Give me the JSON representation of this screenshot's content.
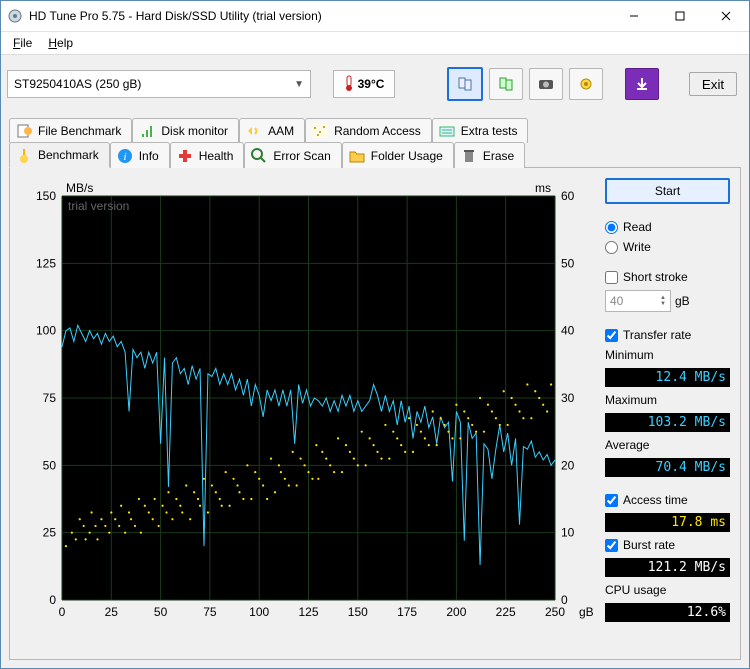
{
  "window": {
    "title": "HD Tune Pro 5.75 - Hard Disk/SSD Utility (trial version)"
  },
  "menu": {
    "file": "File",
    "help": "Help"
  },
  "toolbar": {
    "drive_selected": "ST9250410AS (250 gB)",
    "temperature": "39°C",
    "exit_label": "Exit"
  },
  "tabs_row_top": [
    {
      "label": "File Benchmark",
      "icon": "file-bench-icon"
    },
    {
      "label": "Disk monitor",
      "icon": "disk-monitor-icon"
    },
    {
      "label": "AAM",
      "icon": "aam-icon"
    },
    {
      "label": "Random Access",
      "icon": "random-icon"
    },
    {
      "label": "Extra tests",
      "icon": "extra-icon"
    }
  ],
  "tabs_row_bottom": [
    {
      "label": "Benchmark",
      "icon": "bench-icon",
      "selected": true
    },
    {
      "label": "Info",
      "icon": "info-icon"
    },
    {
      "label": "Health",
      "icon": "health-icon"
    },
    {
      "label": "Error Scan",
      "icon": "error-icon"
    },
    {
      "label": "Folder Usage",
      "icon": "folder-icon"
    },
    {
      "label": "Erase",
      "icon": "erase-icon"
    }
  ],
  "side": {
    "start_label": "Start",
    "read_label": "Read",
    "write_label": "Write",
    "short_stroke_label": "Short stroke",
    "short_stroke_value": "40",
    "short_stroke_unit": "gB",
    "transfer_rate_label": "Transfer rate",
    "min_label": "Minimum",
    "min_value": "12.4 MB/s",
    "max_label": "Maximum",
    "max_value": "103.2 MB/s",
    "avg_label": "Average",
    "avg_value": "70.4 MB/s",
    "access_label": "Access time",
    "access_value": "17.8 ms",
    "burst_label": "Burst rate",
    "burst_value": "121.2 MB/s",
    "cpu_label": "CPU usage",
    "cpu_value": "12.6%"
  },
  "chart_data": {
    "type": "line+scatter",
    "watermark": "trial version",
    "y_left_label": "MB/s",
    "y_right_label": "ms",
    "x_unit": "gB",
    "xlim": [
      0,
      250
    ],
    "ylim_left": [
      0,
      150
    ],
    "ylim_right": [
      0,
      60
    ],
    "x_ticks": [
      0,
      25,
      50,
      75,
      100,
      125,
      150,
      175,
      200,
      225,
      250
    ],
    "y_left_ticks": [
      0,
      25,
      50,
      75,
      100,
      125,
      150
    ],
    "y_right_ticks": [
      0,
      10,
      20,
      30,
      40,
      50,
      60
    ],
    "series": [
      {
        "name": "Transfer rate",
        "color": "#39d0ff",
        "axis": "left",
        "kind": "line",
        "x": [
          0,
          2,
          4,
          6,
          8,
          10,
          12,
          14,
          16,
          18,
          20,
          22,
          24,
          26,
          28,
          30,
          32,
          34,
          36,
          38,
          40,
          42,
          44,
          46,
          48,
          50,
          52,
          54,
          56,
          58,
          60,
          62,
          64,
          66,
          68,
          70,
          72,
          74,
          76,
          78,
          80,
          82,
          84,
          86,
          88,
          90,
          92,
          94,
          96,
          98,
          100,
          102,
          104,
          106,
          108,
          110,
          112,
          114,
          116,
          118,
          120,
          122,
          124,
          126,
          128,
          130,
          132,
          134,
          136,
          138,
          140,
          142,
          144,
          146,
          148,
          150,
          152,
          154,
          156,
          158,
          160,
          162,
          164,
          166,
          168,
          170,
          172,
          174,
          176,
          178,
          180,
          182,
          184,
          186,
          188,
          190,
          192,
          194,
          196,
          198,
          200,
          202,
          204,
          206,
          208,
          210,
          212,
          214,
          216,
          218,
          220,
          222,
          224,
          226,
          228,
          230,
          232,
          234,
          236,
          238,
          240,
          242,
          244,
          246,
          248,
          250
        ],
        "y": [
          94,
          100,
          101,
          96,
          102,
          99,
          96,
          100,
          97,
          99,
          95,
          99,
          96,
          98,
          94,
          96,
          92,
          70,
          93,
          90,
          92,
          86,
          92,
          88,
          92,
          58,
          90,
          42,
          88,
          90,
          84,
          86,
          80,
          87,
          82,
          86,
          20,
          84,
          83,
          86,
          80,
          84,
          80,
          84,
          78,
          82,
          76,
          82,
          72,
          80,
          76,
          68,
          78,
          74,
          78,
          72,
          78,
          72,
          78,
          58,
          80,
          73,
          78,
          72,
          75,
          74,
          72,
          75,
          70,
          74,
          70,
          76,
          72,
          76,
          70,
          74,
          70,
          72,
          74,
          80,
          76,
          70,
          76,
          70,
          74,
          65,
          74,
          66,
          72,
          60,
          70,
          66,
          72,
          64,
          68,
          58,
          68,
          64,
          66,
          44,
          70,
          66,
          22,
          66,
          60,
          62,
          13,
          58,
          56,
          45,
          56,
          65,
          55,
          62,
          50,
          60,
          28,
          57,
          56,
          59,
          53,
          55,
          52,
          54,
          50,
          52
        ]
      },
      {
        "name": "Access time",
        "color": "#ffe600",
        "axis": "right",
        "kind": "scatter",
        "x": [
          2,
          5,
          7,
          9,
          11,
          12,
          14,
          15,
          17,
          18,
          20,
          22,
          24,
          25,
          27,
          29,
          30,
          32,
          34,
          35,
          37,
          39,
          40,
          42,
          44,
          46,
          47,
          49,
          51,
          53,
          54,
          56,
          58,
          60,
          61,
          63,
          65,
          67,
          69,
          70,
          72,
          74,
          76,
          78,
          80,
          81,
          83,
          85,
          87,
          89,
          90,
          92,
          94,
          96,
          98,
          100,
          102,
          104,
          106,
          108,
          110,
          111,
          113,
          115,
          117,
          119,
          121,
          123,
          125,
          127,
          129,
          130,
          132,
          134,
          136,
          138,
          140,
          142,
          144,
          146,
          148,
          150,
          152,
          154,
          156,
          158,
          160,
          162,
          164,
          166,
          168,
          170,
          172,
          174,
          176,
          178,
          180,
          182,
          184,
          186,
          188,
          190,
          192,
          194,
          196,
          198,
          200,
          202,
          204,
          206,
          208,
          210,
          212,
          214,
          216,
          218,
          220,
          222,
          224,
          226,
          228,
          230,
          232,
          234,
          236,
          238,
          240,
          242,
          244,
          246,
          248
        ],
        "y": [
          8,
          10,
          9,
          12,
          11,
          9,
          10,
          13,
          11,
          9,
          12,
          11,
          10,
          13,
          12,
          11,
          14,
          10,
          13,
          12,
          11,
          15,
          10,
          14,
          13,
          12,
          15,
          11,
          14,
          13,
          16,
          12,
          15,
          14,
          13,
          17,
          12,
          16,
          15,
          14,
          18,
          13,
          17,
          16,
          15,
          14,
          19,
          14,
          18,
          17,
          16,
          15,
          20,
          15,
          19,
          18,
          17,
          15,
          21,
          16,
          20,
          19,
          18,
          17,
          22,
          17,
          21,
          20,
          19,
          18,
          23,
          18,
          22,
          21,
          20,
          19,
          24,
          19,
          23,
          22,
          21,
          20,
          25,
          20,
          24,
          23,
          22,
          21,
          26,
          21,
          25,
          24,
          23,
          22,
          27,
          22,
          26,
          25,
          24,
          23,
          28,
          23,
          27,
          26,
          25,
          24,
          29,
          24,
          28,
          27,
          26,
          25,
          30,
          25,
          29,
          28,
          27,
          26,
          31,
          26,
          30,
          29,
          28,
          27,
          32,
          27,
          31,
          30,
          29,
          28,
          32
        ]
      }
    ]
  }
}
